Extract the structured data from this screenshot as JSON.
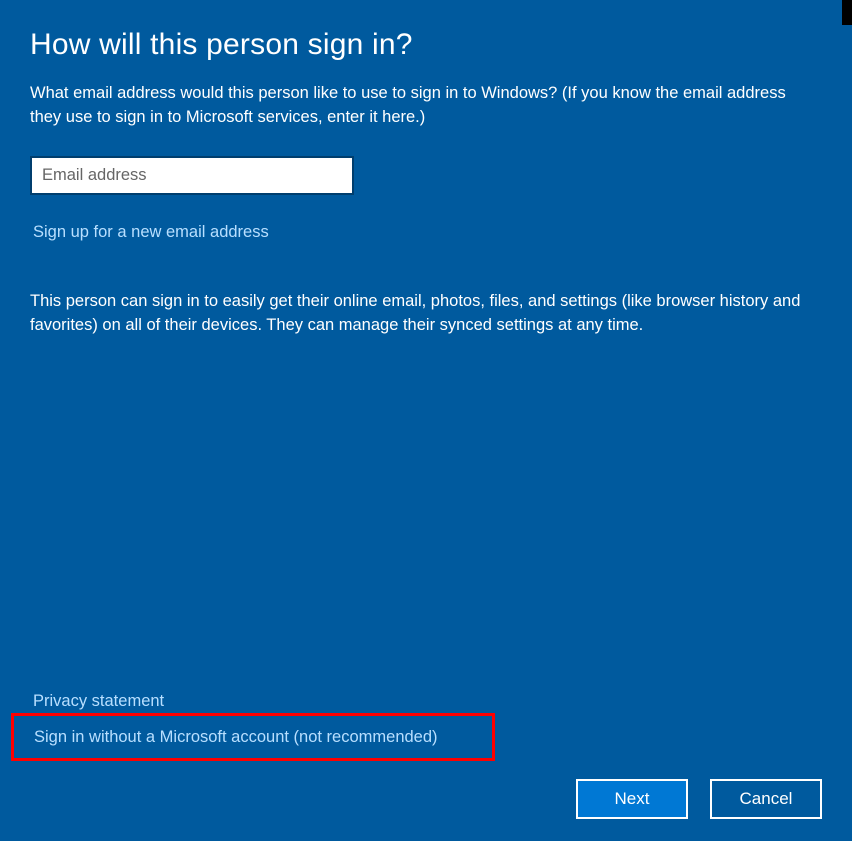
{
  "heading": "How will this person sign in?",
  "subtext": "What email address would this person like to use to sign in to Windows? (If you know the email address they use to sign in to Microsoft services, enter it here.)",
  "email": {
    "placeholder": "Email address",
    "value": ""
  },
  "links": {
    "signup": "Sign up for a new email address",
    "privacy": "Privacy statement",
    "no_account": "Sign in without a Microsoft account (not recommended)"
  },
  "info_text": "This person can sign in to easily get their online email, photos, files, and settings (like browser history and favorites) on all of their devices. They can manage their synced settings at any time.",
  "buttons": {
    "next": "Next",
    "cancel": "Cancel"
  }
}
